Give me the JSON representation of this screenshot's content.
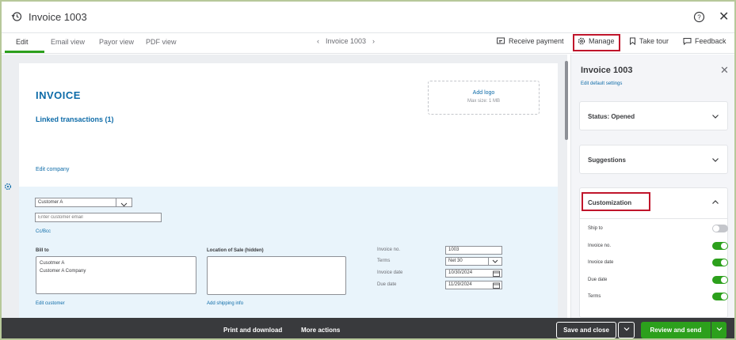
{
  "window": {
    "title": "Invoice 1003"
  },
  "tabs": [
    {
      "label": "Edit"
    },
    {
      "label": "Email view"
    },
    {
      "label": "Payor view"
    },
    {
      "label": "PDF view"
    }
  ],
  "navigator": {
    "prev": "‹",
    "label": "Invoice 1003",
    "next": "›"
  },
  "toolbar": {
    "receive_payment": "Receive payment",
    "manage": "Manage",
    "take_tour": "Take tour",
    "feedback": "Feedback"
  },
  "invoice": {
    "heading": "INVOICE",
    "linked_transactions": "Linked transactions (1)",
    "edit_company": "Edit company",
    "logo": {
      "add": "Add logo",
      "max_size": "Max size: 1 MB"
    },
    "customer": "Customer A",
    "email_placeholder": "Enter customer email",
    "cc_bcc": "Cc/Bcc",
    "bill_to_label": "Bill to",
    "bill_to_lines": [
      "Cusotmer A",
      "Customer A Company"
    ],
    "location_label": "Location of Sale (hidden)",
    "edit_customer": "Edit customer",
    "add_shipping": "Add shipping info",
    "fields": {
      "invoice_no_label": "Invoice no.",
      "invoice_no": "1003",
      "terms_label": "Terms",
      "terms": "Net 30",
      "invoice_date_label": "Invoice date",
      "invoice_date": "10/30/2024",
      "due_date_label": "Due date",
      "due_date": "11/29/2024"
    }
  },
  "panel": {
    "title": "Invoice 1003",
    "edit_defaults": "Edit default settings",
    "status": "Status: Opened",
    "suggestions": "Suggestions",
    "customization": "Customization",
    "toggles": [
      {
        "label": "Ship to",
        "on": false
      },
      {
        "label": "Invoice no.",
        "on": true
      },
      {
        "label": "Invoice date",
        "on": true
      },
      {
        "label": "Due date",
        "on": true
      },
      {
        "label": "Terms",
        "on": true
      }
    ]
  },
  "footer": {
    "print_download": "Print and download",
    "more_actions": "More actions",
    "save_close": "Save and close",
    "review_send": "Review and send"
  },
  "colors": {
    "brand_green": "#2ca01c",
    "link_blue": "#0d6ba8",
    "highlight_red": "#c0152b",
    "footer_dark": "#393a3d"
  }
}
